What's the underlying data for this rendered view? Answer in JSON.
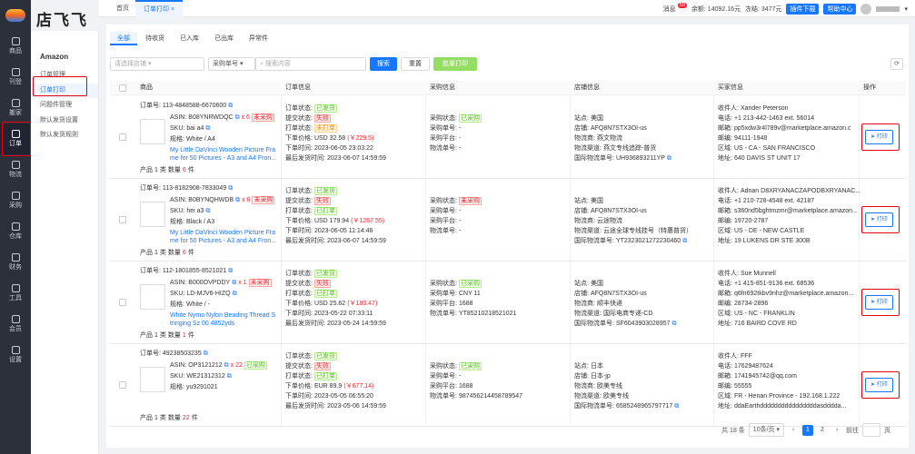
{
  "brand": "店飞飞",
  "sidebar": {
    "items": [
      {
        "label": "商品",
        "icon": "box-icon"
      },
      {
        "label": "刊登",
        "icon": "upload-icon"
      },
      {
        "label": "搬家",
        "icon": "move-icon"
      },
      {
        "label": "订单",
        "icon": "order-icon"
      },
      {
        "label": "物流",
        "icon": "home-icon"
      },
      {
        "label": "采购",
        "icon": "cart-icon"
      },
      {
        "label": "仓库",
        "icon": "warehouse-icon"
      },
      {
        "label": "财务",
        "icon": "finance-icon"
      },
      {
        "label": "工具",
        "icon": "tool-icon"
      },
      {
        "label": "会员",
        "icon": "member-icon"
      },
      {
        "label": "设置",
        "icon": "gear-icon"
      }
    ]
  },
  "subnav": {
    "title": "Amazon",
    "items": [
      "订单管理",
      "订单打印",
      "问题件管理",
      "默认发货设置",
      "默认发货规则"
    ]
  },
  "pagetabs": {
    "home": "首页",
    "current": "订单打印",
    "close": "×"
  },
  "topright": {
    "msg": "消息",
    "msg_count": "58",
    "balance": "余额: 14092.16元",
    "frozen": "冻结: 3477元",
    "plugin": "插件下载",
    "help": "帮助中心"
  },
  "tabs": [
    "全部",
    "待收货",
    "已入库",
    "已出库",
    "异常件"
  ],
  "filters": {
    "store": "请选择店铺",
    "type": "采购单号",
    "search_ph": "搜索内容",
    "search_btn": "搜索",
    "reset_btn": "重置",
    "batch_btn": "批量打印"
  },
  "columns": [
    "商品",
    "订单信息",
    "采购信息",
    "店铺信息",
    "买家信息",
    "操作"
  ],
  "orders": [
    {
      "order_no": "订单号: 113-4848588-6670600",
      "asin": "B08YNRWDQC",
      "qty": "x 6",
      "status": "未采购",
      "sku": "bai a4",
      "spec": "White / A4",
      "title1": "My Little DaVinci Wooden Picture Fra",
      "title2": "me for 50 Pictures - A3 and A4 Fron...",
      "count_kind": "1",
      "count_qty": "6",
      "o_status": "已发货",
      "submit": "失败",
      "print": "未打单",
      "price": "USD 32.58",
      "price_cny": "(￥229.5)",
      "order_time": "2023-06-05 23:03:22",
      "ship_time": "2023-06-07 14:59:59",
      "p_status": "已采购",
      "p_no": "-",
      "p_platform": "-",
      "p_logi": "-",
      "site": "美国",
      "store": "AFQ8N7STX3OI-us",
      "logistics": "燕文物流",
      "channel": "燕文专线追踪-普货",
      "intl_no": "UH936893211YP",
      "buyer": "Xander Peterson",
      "phone": "+1 213-442-1463 ext. 56014",
      "email": "pp5xdw3r4l789v@marketplace.amazon.c",
      "postal": "94111-1948",
      "region": "US - CA - SAN FRANCISCO",
      "address": "640 DAVIS ST UNIT 17",
      "print_btn": "打印"
    },
    {
      "order_no": "订单号: 113-8182908-7833049",
      "asin": "B0BYNQHWDB",
      "qty": "x 6",
      "status": "未采购",
      "sku": "hei a3",
      "spec": "Black / A3",
      "title1": "My Little DaVinci Wooden Picture Fra",
      "title2": "me for 50 Pictures - A3 and A4 Fron...",
      "count_kind": "1",
      "count_qty": "6",
      "o_status": "已发货",
      "submit": "失败",
      "print": "已打单",
      "price": "USD 179.94",
      "price_cny": "(￥1267.55)",
      "order_time": "2023-06-05 11:14:46",
      "ship_time": "2023-06-07 14:59:59",
      "p_status": "未采购",
      "p_no": "-",
      "p_platform": "-",
      "p_logi": "-",
      "site": "美国",
      "store": "AFQ8N7STX3OI-us",
      "logistics": "云途物流",
      "channel": "云途全球专线挂号（特惠普货）",
      "intl_no": "YT2323021272230460",
      "buyer": "Adnan D8XRYANACZAPODBXRYANAC...",
      "phone": "+1 210-728-4548 ext. 42187",
      "email": "s360nd5bghtmzmr@marketplace.amazon...",
      "postal": "19720-2787",
      "region": "US - DE - NEW CASTLE",
      "address": "19 LUKENS DR STE 300B",
      "print_btn": "打印"
    },
    {
      "order_no": "订单号: 112-1801855-8521021",
      "asin": "B000OVPDDY",
      "qty": "x 1",
      "status": "未采购",
      "sku": "LD-MJV6-HIZQ",
      "spec": "White / -",
      "title1": "White Nymo Nylon Beading Thread S",
      "title2": "tringing Sz 00 4852yds",
      "count_kind": "1",
      "count_qty": "1",
      "o_status": "已发货",
      "submit": "失败",
      "print": "已打单",
      "price": "USD 25.62",
      "price_cny": "(￥180.47)",
      "order_time": "2023-05-22 07:33:11",
      "ship_time": "2023-05-24 14:59:59",
      "p_status": "已采购",
      "p_no": "CNY 11",
      "p_platform": "1688",
      "p_logi": "YT85210218521021",
      "site": "美国",
      "store": "AFQ8N7STX3OI-us",
      "logistics": "顺丰快递",
      "channel": "国际电商专递-CD",
      "intl_no": "SF6043903028957",
      "buyer": "Sue Munnell",
      "phone": "+1 415-851-9136 ext. 68536",
      "email": "q6fn692tkbv9nhz@marketplace.amazon...",
      "postal": "28734-2896",
      "region": "US - NC - FRANKLIN",
      "address": "716 BAIRD COVE RD",
      "print_btn": "打印"
    },
    {
      "order_no": "订单号: 49238503235",
      "asin": "OP3121212",
      "qty": "x 22",
      "status": "已采购",
      "sku": "WE21312312",
      "spec": "yu9291021",
      "title1": "",
      "title2": "",
      "count_kind": "1",
      "count_qty": "22",
      "o_status": "已发货",
      "submit": "失败",
      "print": "已打单",
      "price": "EUR 89.9",
      "price_cny": "(￥677.14)",
      "order_time": "2023-05-05 06:55:20",
      "ship_time": "2023-05-06 14:59:59",
      "p_status": "已采购",
      "p_no": "-",
      "p_platform": "1688",
      "p_logi": "987456214458789547",
      "site": "日本",
      "store": "日本-jp",
      "logistics": "欧美专线",
      "channel": "欧美专线",
      "intl_no": "6585248965797717",
      "buyer": "FFF",
      "phone": "17629487624",
      "email": "1741945742@qq.com",
      "postal": "55555",
      "region": "FR - Henan Province - 192.168.1.222",
      "address": "ddaEarthddddddddddddddddasdddda...",
      "print_btn": "打印"
    }
  ],
  "labels": {
    "order_status": "订单状态:",
    "submit": "提交状态:",
    "print": "打单状态:",
    "price": "下单价格:",
    "order_time": "下单时间:",
    "ship_time": "最后发货时间:",
    "p_status": "采购状态:",
    "p_no": "采购单号:",
    "p_platform": "采购平台:",
    "p_logi": "物流单号:",
    "site": "站点:",
    "store": "店铺:",
    "logistics": "物流商:",
    "channel": "物流渠道:",
    "intl": "国际物流单号:",
    "buyer": "收件人:",
    "phone": "电话:",
    "email": "邮箱:",
    "postal": "邮编:",
    "region": "区域:",
    "address": "地址:",
    "asin": "ASIN:",
    "sku": "SKU:",
    "spec": "规格:",
    "kind": "产品",
    "kind_unit": "类",
    "qty": "数量",
    "qty_unit": "件"
  },
  "pager": {
    "total": "共 18 条",
    "size": "10条/页",
    "page1": "1",
    "page2": "2",
    "goto": "前往",
    "page_unit": "页"
  }
}
